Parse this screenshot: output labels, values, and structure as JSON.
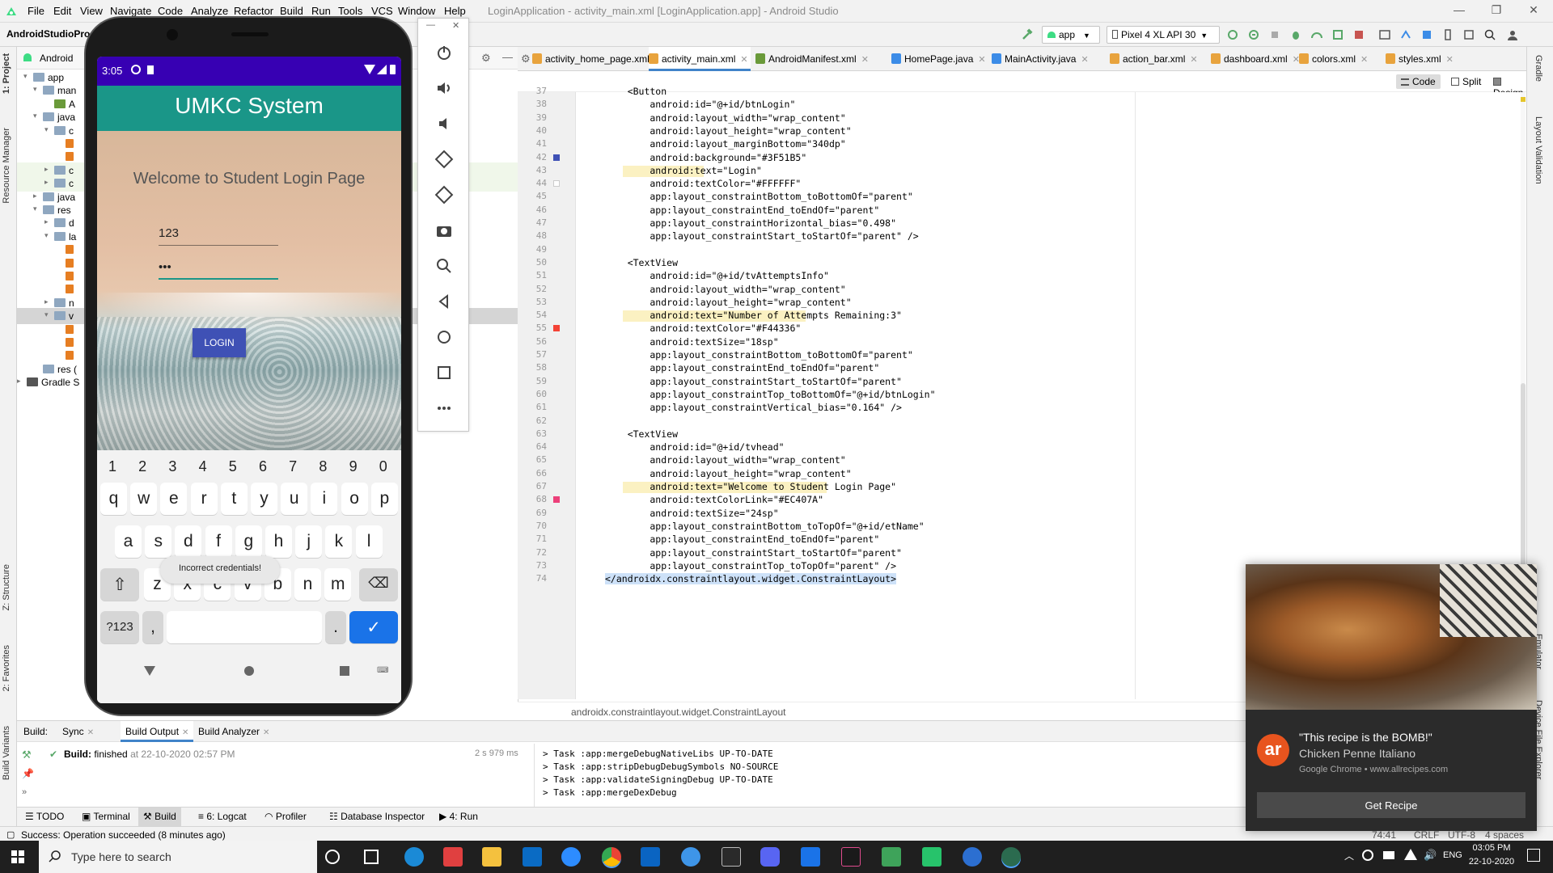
{
  "menubar": {
    "items": [
      "File",
      "Edit",
      "View",
      "Navigate",
      "Code",
      "Analyze",
      "Refactor",
      "Build",
      "Run",
      "Tools",
      "VCS",
      "Window",
      "Help"
    ],
    "window_title": "LoginApplication - activity_main.xml [LoginApplication.app] - Android Studio"
  },
  "toolbar": {
    "project": "AndroidStudioPro",
    "run_config": "app",
    "device": "Pixel 4 XL API 30"
  },
  "left_stripe": {
    "tabs": [
      "1: Project",
      "Resource Manager",
      "Z: Structure",
      "2: Favorites",
      "Build Variants"
    ]
  },
  "right_stripe": {
    "tabs": [
      "Gradle",
      "Layout Validation",
      "Emulator",
      "Device File Explorer"
    ]
  },
  "project_panel": {
    "view": "Android",
    "rows": [
      {
        "label": "app",
        "arrow": "▾"
      },
      {
        "label": "man",
        "arrow": "▾"
      },
      {
        "label": "A",
        "arrow": ""
      },
      {
        "label": "java",
        "arrow": "▾"
      },
      {
        "label": "c",
        "arrow": "▾"
      },
      {
        "label": "",
        "arrow": ""
      },
      {
        "label": "",
        "arrow": ""
      },
      {
        "label": "c",
        "arrow": "▸"
      },
      {
        "label": "c",
        "arrow": "▸"
      },
      {
        "label": "java",
        "arrow": "▸"
      },
      {
        "label": "res",
        "arrow": "▾"
      },
      {
        "label": "d",
        "arrow": "▸"
      },
      {
        "label": "la",
        "arrow": "▾"
      },
      {
        "label": "",
        "arrow": ""
      },
      {
        "label": "",
        "arrow": ""
      },
      {
        "label": "",
        "arrow": ""
      },
      {
        "label": "",
        "arrow": ""
      },
      {
        "label": "n",
        "arrow": "▸"
      },
      {
        "label": "v",
        "arrow": "▾"
      },
      {
        "label": "",
        "arrow": ""
      },
      {
        "label": "",
        "arrow": ""
      },
      {
        "label": "",
        "arrow": ""
      },
      {
        "label": "res (",
        "arrow": ""
      },
      {
        "label": "Gradle S",
        "arrow": "▸"
      }
    ]
  },
  "editor_tabs": [
    {
      "label": "activity_home_page.xml",
      "color": "#e8a33d",
      "active": false
    },
    {
      "label": "activity_main.xml",
      "color": "#e8a33d",
      "active": true
    },
    {
      "label": "AndroidManifest.xml",
      "color": "#6a9a3a",
      "active": false
    },
    {
      "label": "HomePage.java",
      "color": "#3c8ce7",
      "active": false
    },
    {
      "label": "MainActivity.java",
      "color": "#3c8ce7",
      "active": false
    },
    {
      "label": "action_bar.xml",
      "color": "#e8a33d",
      "active": false
    },
    {
      "label": "dashboard.xml",
      "color": "#e8a33d",
      "active": false
    },
    {
      "label": "colors.xml",
      "color": "#e8a33d",
      "active": false
    },
    {
      "label": "styles.xml",
      "color": "#e8a33d",
      "active": false
    }
  ],
  "view_modes": [
    "Code",
    "Split",
    "Design"
  ],
  "code_lines": [
    {
      "n": "37",
      "t": "    <Button"
    },
    {
      "n": "38",
      "t": "        android:id=\"@+id/btnLogin\""
    },
    {
      "n": "39",
      "t": "        android:layout_width=\"wrap_content\""
    },
    {
      "n": "40",
      "t": "        android:layout_height=\"wrap_content\""
    },
    {
      "n": "41",
      "t": "        android:layout_marginBottom=\"340dp\""
    },
    {
      "n": "42",
      "t": "        android:background=\"#3F51B5\""
    },
    {
      "n": "43",
      "t": "        android:text=\"Login\""
    },
    {
      "n": "44",
      "t": "        android:textColor=\"#FFFFFF\""
    },
    {
      "n": "45",
      "t": "        app:layout_constraintBottom_toBottomOf=\"parent\""
    },
    {
      "n": "46",
      "t": "        app:layout_constraintEnd_toEndOf=\"parent\""
    },
    {
      "n": "47",
      "t": "        app:layout_constraintHorizontal_bias=\"0.498\""
    },
    {
      "n": "48",
      "t": "        app:layout_constraintStart_toStartOf=\"parent\" />"
    },
    {
      "n": "49",
      "t": ""
    },
    {
      "n": "50",
      "t": "    <TextView"
    },
    {
      "n": "51",
      "t": "        android:id=\"@+id/tvAttemptsInfo\""
    },
    {
      "n": "52",
      "t": "        android:layout_width=\"wrap_content\""
    },
    {
      "n": "53",
      "t": "        android:layout_height=\"wrap_content\""
    },
    {
      "n": "54",
      "t": "        android:text=\"Number of Attempts Remaining:3\""
    },
    {
      "n": "55",
      "t": "        android:textColor=\"#F44336\""
    },
    {
      "n": "56",
      "t": "        android:textSize=\"18sp\""
    },
    {
      "n": "57",
      "t": "        app:layout_constraintBottom_toBottomOf=\"parent\""
    },
    {
      "n": "58",
      "t": "        app:layout_constraintEnd_toEndOf=\"parent\""
    },
    {
      "n": "59",
      "t": "        app:layout_constraintStart_toStartOf=\"parent\""
    },
    {
      "n": "60",
      "t": "        app:layout_constraintTop_toBottomOf=\"@+id/btnLogin\""
    },
    {
      "n": "61",
      "t": "        app:layout_constraintVertical_bias=\"0.164\" />"
    },
    {
      "n": "62",
      "t": ""
    },
    {
      "n": "63",
      "t": "    <TextView"
    },
    {
      "n": "64",
      "t": "        android:id=\"@+id/tvhead\""
    },
    {
      "n": "65",
      "t": "        android:layout_width=\"wrap_content\""
    },
    {
      "n": "66",
      "t": "        android:layout_height=\"wrap_content\""
    },
    {
      "n": "67",
      "t": "        android:text=\"Welcome to Student Login Page\""
    },
    {
      "n": "68",
      "t": "        android:textColorLink=\"#EC407A\""
    },
    {
      "n": "69",
      "t": "        android:textSize=\"24sp\""
    },
    {
      "n": "70",
      "t": "        app:layout_constraintBottom_toTopOf=\"@+id/etName\""
    },
    {
      "n": "71",
      "t": "        app:layout_constraintEnd_toEndOf=\"parent\""
    },
    {
      "n": "72",
      "t": "        app:layout_constraintStart_toStartOf=\"parent\""
    },
    {
      "n": "73",
      "t": "        app:layout_constraintTop_toTopOf=\"parent\" />"
    },
    {
      "n": "74",
      "t": "</androidx.constraintlayout.widget.ConstraintLayout>"
    }
  ],
  "gutter_colors": {
    "42": "#3F51B5",
    "44": "#FFFFFF",
    "55": "#F44336",
    "68": "#EC407A"
  },
  "breadcrumb": "androidx.constraintlayout.widget.ConstraintLayout",
  "phone": {
    "time": "3:05",
    "app_title": "UMKC System",
    "welcome": "Welcome to Student Login Page",
    "username": "123",
    "password": "•••",
    "login_button": "LOGIN",
    "toast": "Incorrect credentials!",
    "keyboard": {
      "numbers": [
        "1",
        "2",
        "3",
        "4",
        "5",
        "6",
        "7",
        "8",
        "9",
        "0"
      ],
      "row1": [
        "q",
        "w",
        "e",
        "r",
        "t",
        "y",
        "u",
        "i",
        "o",
        "p"
      ],
      "row2": [
        "a",
        "s",
        "d",
        "f",
        "g",
        "h",
        "j",
        "k",
        "l"
      ],
      "row3": [
        "z",
        "x",
        "c",
        "v",
        "b",
        "n",
        "m"
      ],
      "symbols_key": "?123",
      "comma_key": ",",
      "period_key": "."
    }
  },
  "build_panel": {
    "label": "Build:",
    "tabs": [
      "Sync",
      "Build Output",
      "Build Analyzer"
    ],
    "status_bold": "Build:",
    "status_text": "finished",
    "status_time": "at 22-10-2020 02:57 PM",
    "duration": "2 s 979 ms",
    "tasks": [
      "> Task :app:mergeDebugNativeLibs UP-TO-DATE",
      "> Task :app:stripDebugDebugSymbols NO-SOURCE",
      "> Task :app:validateSigningDebug UP-TO-DATE",
      "> Task :app:mergeDexDebug"
    ]
  },
  "bottom_tabs": [
    "TODO",
    "Terminal",
    "Build",
    "6: Logcat",
    "Profiler",
    "Database Inspector",
    "4: Run"
  ],
  "status_line": {
    "message": "Success: Operation succeeded (8 minutes ago)",
    "right": [
      "74:41",
      "CRLF",
      "UTF-8",
      "4 spaces"
    ]
  },
  "notification": {
    "title": "\"This recipe is the BOMB!\"",
    "subtitle": "Chicken Penne Italiano",
    "source": "Google Chrome • www.allrecipes.com",
    "badge": "ar",
    "button": "Get Recipe"
  },
  "taskbar": {
    "search_placeholder": "Type here to search",
    "lang": "ENG",
    "time": "03:05 PM",
    "date": "22-10-2020"
  }
}
